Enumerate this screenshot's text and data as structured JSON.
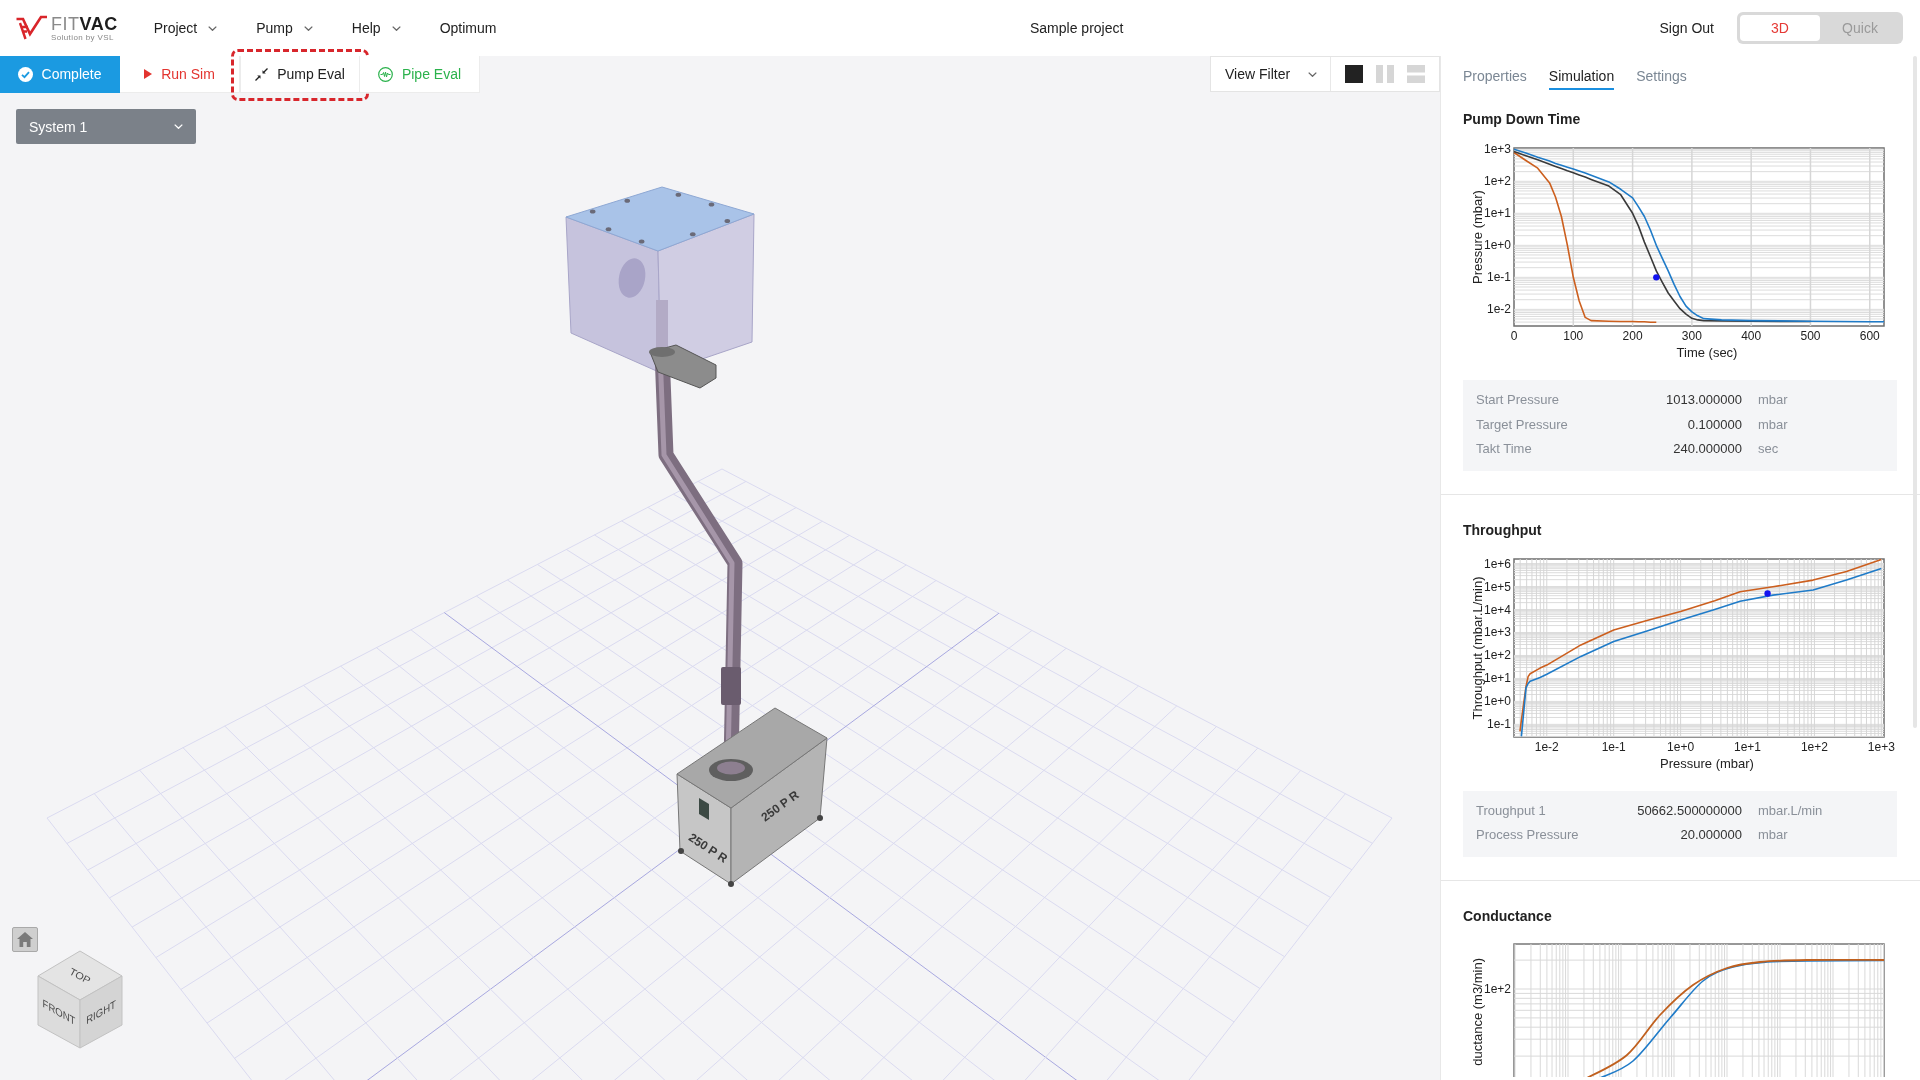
{
  "header": {
    "logo": {
      "wordmark": "FIT**VAC**",
      "tagline": "Solution by VSL"
    },
    "menu": [
      {
        "label": "Project",
        "has_dropdown": true
      },
      {
        "label": "Pump",
        "has_dropdown": true
      },
      {
        "label": "Help",
        "has_dropdown": true
      },
      {
        "label": "Optimum",
        "has_dropdown": false
      }
    ],
    "project_title": "Sample project",
    "sign_out": "Sign Out",
    "view_modes": [
      {
        "label": "3D",
        "selected": true
      },
      {
        "label": "Quick",
        "selected": false
      }
    ]
  },
  "toolbar": {
    "actions": [
      {
        "kind": "complete",
        "label": "Complete",
        "highlighted": false
      },
      {
        "kind": "run",
        "label": "Run Sim",
        "highlighted": false
      },
      {
        "kind": "pump_eval",
        "label": "Pump Eval",
        "highlighted": true
      },
      {
        "kind": "pipe_eval",
        "label": "Pipe Eval",
        "highlighted": false
      }
    ],
    "view_filter": "View Filter",
    "layouts": [
      {
        "kind": "single",
        "selected": true
      },
      {
        "kind": "columns",
        "selected": false
      },
      {
        "kind": "rows",
        "selected": false
      }
    ]
  },
  "system_select": {
    "value": "System 1"
  },
  "scene": {
    "pump_labels": [
      "250 P R",
      "250 P R"
    ],
    "view_cube": [
      "TOP",
      "FRONT",
      "RIGHT"
    ]
  },
  "side_panel": {
    "tabs": [
      {
        "label": "Properties",
        "selected": false
      },
      {
        "label": "Simulation",
        "selected": true
      },
      {
        "label": "Settings",
        "selected": false
      }
    ],
    "sections": [
      {
        "kind": "pump_down_chart",
        "title": "Pump Down Time",
        "xlabel": "Time (sec)",
        "ylabel": "Pressure (mbar)",
        "xtick_labels": [
          "0",
          "100",
          "200",
          "300",
          "400",
          "500",
          "600"
        ],
        "ytick_labels": [
          "1e+3",
          "1e+2",
          "1e+1",
          "1e+0",
          "1e-1",
          "1e-2"
        ],
        "properties": [
          {
            "label": "Start Pressure",
            "value": "1013.000000",
            "unit": "mbar"
          },
          {
            "label": "Target Pressure",
            "value": "0.100000",
            "unit": "mbar"
          },
          {
            "label": "Takt Time",
            "value": "240.000000",
            "unit": "sec"
          }
        ]
      },
      {
        "kind": "throughput_chart",
        "title": "Throughput",
        "xlabel": "Pressure (mbar)",
        "ylabel": "Throughput (mbar.L/min)",
        "xtick_labels": [
          "1e-2",
          "1e-1",
          "1e+0",
          "1e+1",
          "1e+2",
          "1e+3"
        ],
        "ytick_labels": [
          "1e+6",
          "1e+5",
          "1e+4",
          "1e+3",
          "1e+2",
          "1e+1",
          "1e+0",
          "1e-1"
        ],
        "properties": [
          {
            "label": "Troughput 1",
            "value": "50662.500000000",
            "unit": "mbar.L/min"
          },
          {
            "label": "Process Pressure",
            "value": "20.000000",
            "unit": "mbar"
          }
        ]
      },
      {
        "kind": "conductance_chart",
        "title": "Conductance",
        "ylabel": "ductance (m3/min)",
        "ytick_labels": [
          "1e+2"
        ]
      }
    ]
  }
}
